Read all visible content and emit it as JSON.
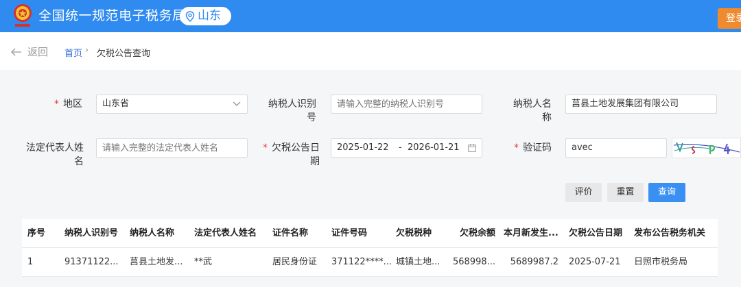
{
  "header": {
    "site_title": "全国统一规范电子税务局",
    "region": "山东",
    "login": "登录",
    "emblem_icon": "tax-emblem-icon",
    "colors": {
      "primary": "#2f8bf0",
      "login": "#f08a2e",
      "required": "#e4393c"
    }
  },
  "breadcrumb": {
    "back": "返回",
    "home": "首页",
    "separator": "›",
    "current": "欠税公告查询"
  },
  "form": {
    "region_label": "地区",
    "region_value": "山东省",
    "taxpayer_id_label": "纳税人识别号",
    "taxpayer_id_placeholder": "请输入完整的纳税人识别号",
    "taxpayer_name_label": "纳税人名称",
    "taxpayer_name_value": "莒县土地发展集团有限公司",
    "legal_rep_label": "法定代表人姓名",
    "legal_rep_placeholder": "请输入完整的法定代表人姓名",
    "date_label": "欠税公告日期",
    "date_start": "2025-01-22",
    "date_sep": "-",
    "date_end": "2026-01-21",
    "captcha_label": "验证码",
    "captcha_value": "avec"
  },
  "buttons": {
    "evaluate": "评价",
    "reset": "重置",
    "query": "查询"
  },
  "table": {
    "headers": [
      "序号",
      "纳税人识别号",
      "纳税人名称",
      "法定代表人姓名",
      "证件名称",
      "证件号码",
      "欠税税种",
      "欠税余额",
      "本月新发生...",
      "欠税公告日期",
      "发布公告税务机关"
    ],
    "rows": [
      [
        "1",
        "91371122...",
        "莒县土地发...",
        "**武",
        "居民身份证",
        "371122****...",
        "城镇土地...",
        "568998...",
        "5689987.2",
        "2025-07-21",
        "日照市税务局"
      ]
    ]
  }
}
